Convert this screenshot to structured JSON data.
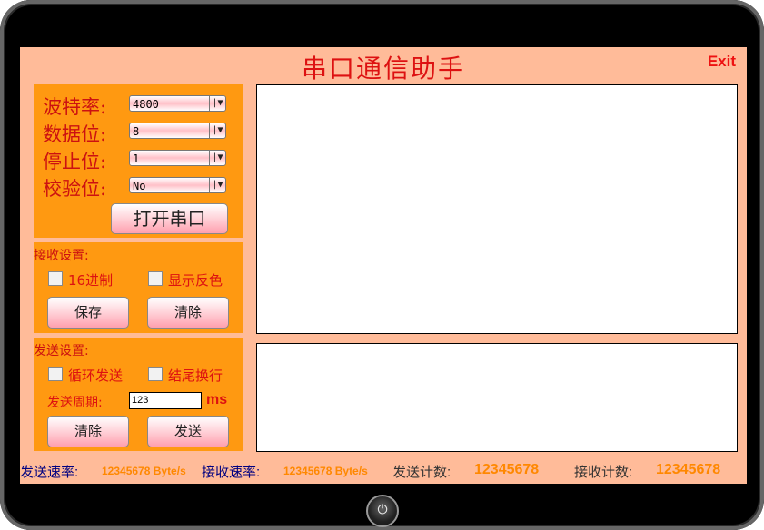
{
  "title": "串口通信助手",
  "exit_label": "Exit",
  "serial": {
    "baud_label": "波特率:",
    "baud_value": "4800",
    "databits_label": "数据位:",
    "databits_value": "8",
    "stopbits_label": "停止位:",
    "stopbits_value": "1",
    "parity_label": "校验位:",
    "parity_value": "No",
    "open_button": "打开串口"
  },
  "receive": {
    "title": "接收设置:",
    "hex_label": "16进制",
    "invert_label": "显示反色",
    "save_button": "保存",
    "clear_button": "清除"
  },
  "send": {
    "title": "发送设置:",
    "loop_label": "循环发送",
    "newline_label": "结尾换行",
    "period_label": "发送周期:",
    "period_value": "123",
    "period_unit": "ms",
    "clear_button": "清除",
    "send_button": "发送"
  },
  "status": {
    "send_rate_label": "发送速率:",
    "send_rate_value": "12345678 Byte/s",
    "recv_rate_label": "接收速率:",
    "recv_rate_value": "12345678 Byte/s",
    "send_count_label": "发送计数:",
    "send_count_value": "12345678",
    "recv_count_label": "接收计数:",
    "recv_count_value": "12345678"
  },
  "icons": {
    "dropdown": "chevron-down-icon",
    "power": "power-icon"
  },
  "colors": {
    "screen_bg": "#ffbb99",
    "panel_bg": "#ff9911",
    "accent_red": "#dd1111",
    "value_orange": "#ff8800"
  }
}
